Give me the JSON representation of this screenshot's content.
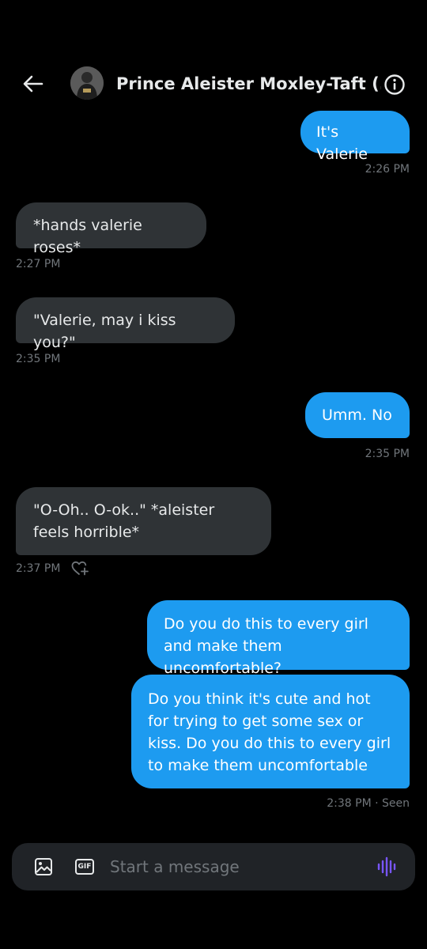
{
  "header": {
    "title": "Prince Aleister Moxley-Taft (...",
    "back_icon": "arrow-left-icon",
    "info_icon": "info-icon"
  },
  "messages": [
    {
      "side": "sent",
      "text": "It's Valerie",
      "time": "2:26 PM"
    },
    {
      "side": "received",
      "text": "*hands valerie roses*",
      "time": "2:27 PM"
    },
    {
      "side": "received",
      "text": "\"Valerie, may i kiss you?\"",
      "time": "2:35 PM"
    },
    {
      "side": "sent",
      "text": "Umm. No",
      "time": "2:35 PM"
    },
    {
      "side": "received",
      "text": "\"O-Oh.. O-ok..\" *aleister feels horrible*",
      "time": "2:37 PM"
    },
    {
      "side": "sent",
      "text": "Do you do this to every girl and make them uncomfortable?"
    },
    {
      "side": "sent",
      "text": "Do you think it's cute and hot for trying to get some sex or kiss. Do you do this to every girl to make them uncomfortable",
      "time": "2:38 PM · Seen"
    }
  ],
  "composer": {
    "placeholder": "Start a message",
    "media_icon": "image-icon",
    "gif_label": "GIF",
    "voice_icon": "voice-wave-icon"
  },
  "colors": {
    "background": "#000000",
    "sent_bubble": "#1d9bf0",
    "received_bubble": "#2f3336",
    "timestamp": "#71767b",
    "voice_accent": "#7856ff"
  }
}
